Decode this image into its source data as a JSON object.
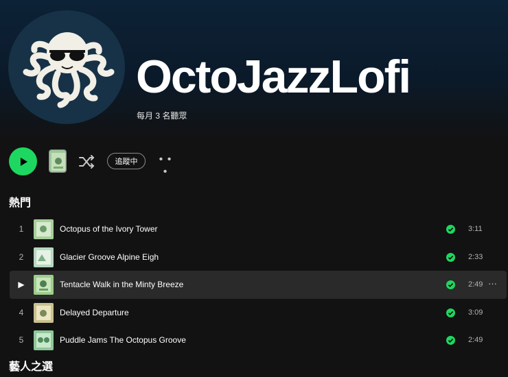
{
  "artist": {
    "name": "OctoJazzLofi",
    "monthly_listeners": "每月 3 名聽眾"
  },
  "controls": {
    "follow_label": "追蹤中",
    "more_label": "• • •"
  },
  "sections": {
    "popular": "熱門",
    "artist_pick": "藝人之選"
  },
  "tracks": [
    {
      "num": "1",
      "title": "Octopus of the Ivory Tower",
      "duration": "3:11",
      "saved": true
    },
    {
      "num": "2",
      "title": "Glacier Groove Alpine Eigh",
      "duration": "2:33",
      "saved": true
    },
    {
      "num": "▶",
      "title": "Tentacle Walk in the Minty Breeze",
      "duration": "2:49",
      "saved": true,
      "more": "···"
    },
    {
      "num": "4",
      "title": "Delayed Departure",
      "duration": "3:09",
      "saved": true
    },
    {
      "num": "5",
      "title": "Puddle Jams The Octopus Groove",
      "duration": "2:49",
      "saved": true
    }
  ],
  "colors": {
    "accent": "#1ed760",
    "background": "#121212",
    "hero": "#0c2236",
    "active_row": "#2a2a2a"
  },
  "icons": [
    "octopus-avatar",
    "play-icon",
    "shuffle-icon",
    "more-icon",
    "check-icon"
  ]
}
